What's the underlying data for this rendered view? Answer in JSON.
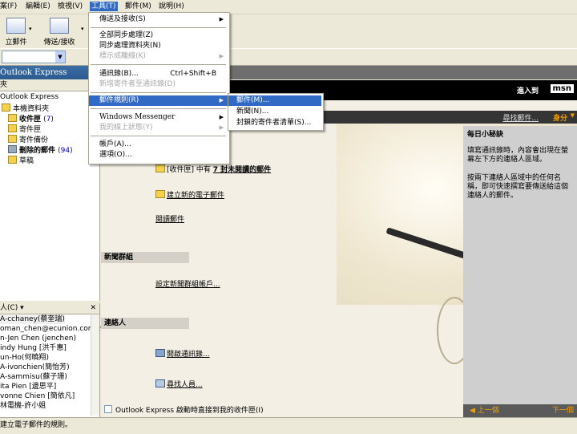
{
  "menubar": {
    "items": [
      "案(F)",
      "編輯(E)",
      "檢視(V)",
      "工具(T)",
      "郵件(M)",
      "說明(H)"
    ]
  },
  "toolbar": {
    "create_mail": "立郵件",
    "send_receive": "傳送/接收"
  },
  "window_title": "Outlook Express",
  "msn_label": "進入到",
  "msn_logo": "msn",
  "folder_pane": {
    "header": "夾",
    "folders": [
      {
        "name": "Outlook Express",
        "count": ""
      },
      {
        "name": "本機資料夾",
        "count": ""
      },
      {
        "name": "收件匣",
        "count": "(7)"
      },
      {
        "name": "寄件匣",
        "count": ""
      },
      {
        "name": "寄件備份",
        "count": ""
      },
      {
        "name": "刪除的郵件",
        "count": "(94)"
      },
      {
        "name": "草稿",
        "count": ""
      }
    ]
  },
  "contacts_pane": {
    "header": "人(C) ▾",
    "close": "✕",
    "contacts": [
      "A-cchaney(蔡奎瑞)",
      "oman_chen@ecunion.com.tw",
      "n-Jen Chen (jenchen)",
      "indy Hung [洪千惠]",
      "un-Ho(何曉翔)",
      "A-ivonchien(簡怡芳)",
      "A-sammisu(蘇子珊)",
      "ita Pien [邊思平]",
      "vonne Chien [簡依凡]",
      "林電機-許小姐"
    ]
  },
  "main": {
    "find_label": "尋找郵件...",
    "identity_label": "身分",
    "mail_section": {
      "unread_prefix": "[收件匣] 中有",
      "unread_link": "7 封未閱讀的郵件",
      "create_link": "建立新的電子郵件",
      "read_link": "閱讀郵件"
    },
    "news_section": {
      "header": "新聞群組",
      "setup_link": "設定新聞群組帳戶..."
    },
    "contacts_section": {
      "header": "連絡人",
      "open_addressbook": "開啟通訊錄...",
      "find_people": "尋找人員..."
    },
    "startup_checkbox": "Outlook Express 啟動時直接到我的收件匣(I)"
  },
  "tip": {
    "title": "每日小秘訣",
    "paragraph1": "填寫通訊錄時，內容會出現在螢幕左下方的連絡人區域。",
    "paragraph2": "按兩下連絡人區域中的任何名稱，即可快速撰寫要傳送給這個連絡人的郵件。",
    "prev": "◀ 上一個",
    "next": "下一個"
  },
  "status_bar": {
    "text": "建立電子郵件的規則。"
  },
  "tools_menu": {
    "items": [
      {
        "label": "傳送及接收(S)",
        "shortcut": "",
        "submenu": true,
        "disabled": false
      },
      {
        "label": "全部同步處理(Z)",
        "shortcut": "",
        "submenu": false,
        "disabled": false
      },
      {
        "label": "同步處理資料夾(N)",
        "shortcut": "",
        "submenu": false,
        "disabled": false
      },
      {
        "label": "標示成離線(K)",
        "shortcut": "",
        "submenu": true,
        "disabled": true
      },
      {
        "label": "通訊錄(B)...",
        "shortcut": "Ctrl+Shift+B",
        "submenu": false,
        "disabled": false
      },
      {
        "label": "新增寄件者至通訊錄(D)",
        "shortcut": "",
        "submenu": false,
        "disabled": true
      },
      {
        "label": "郵件規則(R)",
        "shortcut": "",
        "submenu": true,
        "disabled": false
      },
      {
        "label": "Windows Messenger",
        "shortcut": "",
        "submenu": true,
        "disabled": false
      },
      {
        "label": "我的線上狀態(Y)",
        "shortcut": "",
        "submenu": true,
        "disabled": true
      },
      {
        "label": "帳戶(A)...",
        "shortcut": "",
        "submenu": false,
        "disabled": false
      },
      {
        "label": "選項(O)...",
        "shortcut": "",
        "submenu": false,
        "disabled": false
      }
    ]
  },
  "rules_submenu": {
    "items": [
      "郵件(M)...",
      "新聞(N)...",
      "封鎖的寄件者清單(S)..."
    ]
  },
  "colors": {
    "highlight": "#316ac5",
    "chrome": "#ece9d8",
    "accent_orange": "#f0a000"
  }
}
